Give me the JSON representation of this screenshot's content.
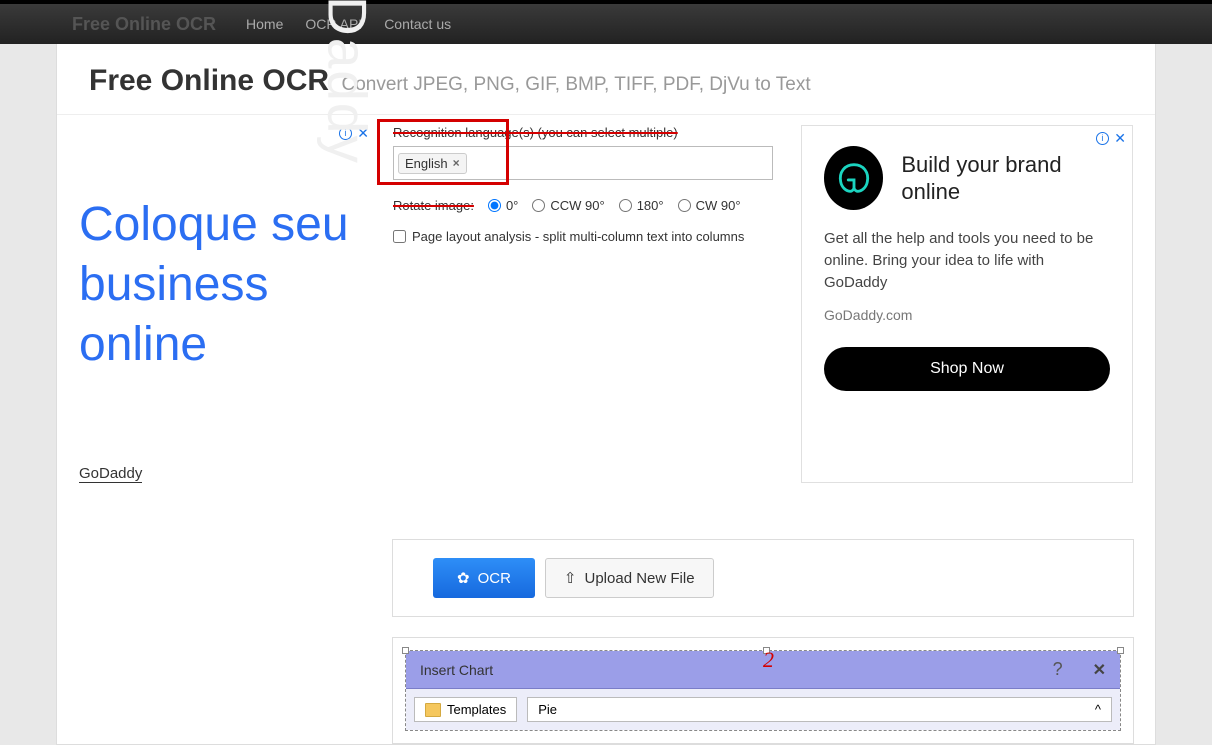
{
  "nav": {
    "brand": "Free Online OCR",
    "links": [
      "Home",
      "OCR API",
      "Contact us"
    ]
  },
  "header": {
    "title": "Free Online OCR",
    "subtitle": "Convert JPEG, PNG, GIF, BMP, TIFF, PDF, DjVu to Text"
  },
  "form": {
    "lang_label": "Recognition language(s) (you can select multiple)",
    "lang_tag": "English",
    "rotate_label": "Rotate image:",
    "rotate_options": [
      "0°",
      "CCW 90°",
      "180°",
      "CW 90°"
    ],
    "layout_label": "Page layout analysis - split multi-column text into columns"
  },
  "actions": {
    "ocr": "OCR",
    "upload": "Upload New File"
  },
  "left_ad": {
    "watermark": "GoDaddy",
    "headline": "Coloque seu business online",
    "domain": "GoDaddy"
  },
  "right_ad": {
    "title": "Build your brand online",
    "desc": "Get all the help and tools you need to be online. Bring your idea to life with GoDaddy",
    "site": "GoDaddy.com",
    "cta": "Shop Now"
  },
  "result": {
    "window_title": "Insert Chart",
    "templates": "Templates",
    "pie": "Pie",
    "annotation": "2"
  }
}
